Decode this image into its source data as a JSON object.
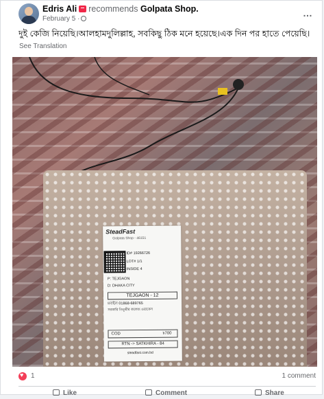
{
  "post": {
    "author": "Edris Ali",
    "action_text": "recommends",
    "page_name": "Golpata Shop.",
    "date": "February 5 ·",
    "more_icon": "…",
    "body_text": "দুই কেজি নিয়েছি।আলহামদুলিল্লাহ, সবকিছু ঠিক মনে হয়েছে।এক দিন পর হাতে পেয়েছি।",
    "see_translation": "See Translation"
  },
  "label": {
    "brand": "SteadFast",
    "sub": "Golpata Shop - 46151",
    "id_line": "ID# 19266726",
    "lot_line": "LOT# 1/1",
    "inside": "INSIDE 4",
    "p_line": "P: TEJGAON",
    "d_line": "D: DHAKA CITY",
    "hub": "TEJGAON - 12",
    "phone": "মবাইল 01868-689765",
    "address": "সরকারি তিতুমীর কলেজ ওয়াকেস",
    "cod_label": "COD",
    "cod_value": "৳700",
    "route": "RTN -> SATKHIRA - 84",
    "site": "steadfast.com.bd"
  },
  "footer": {
    "reaction_count": "1",
    "comment_count": "1 comment",
    "actions": [
      "Like",
      "Comment",
      "Share"
    ]
  },
  "colors": {
    "accent_red": "#f33e58",
    "text_secondary": "#65676b"
  }
}
